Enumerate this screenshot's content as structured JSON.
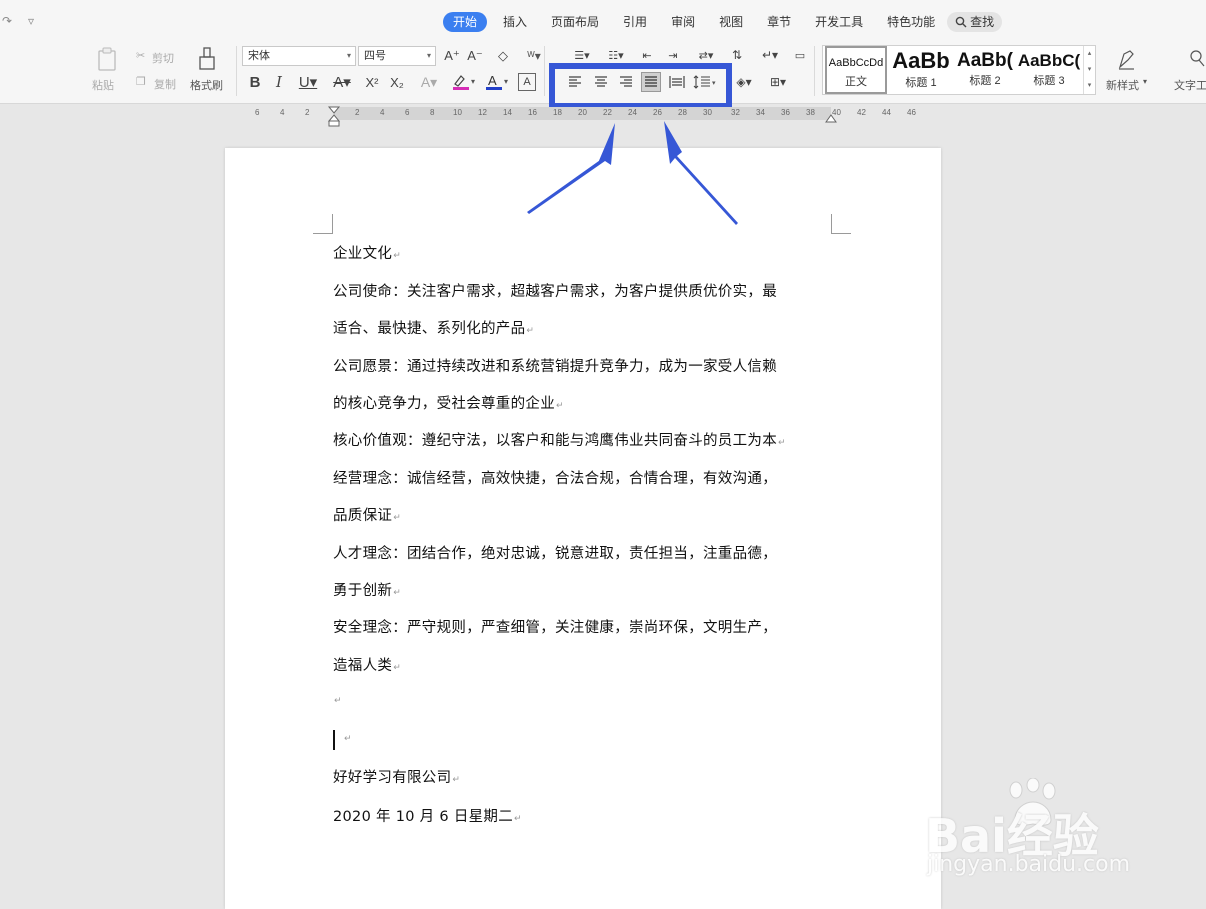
{
  "quick_access": {
    "redo_icon": "redo-icon",
    "more_icon": "dropdown-icon"
  },
  "tabs": [
    "开始",
    "插入",
    "页面布局",
    "引用",
    "审阅",
    "视图",
    "章节",
    "开发工具",
    "特色功能"
  ],
  "search_tab": "查找",
  "clipboard": {
    "paste": "粘贴",
    "cut": "剪切",
    "copy": "复制",
    "format_painter": "格式刷"
  },
  "font": {
    "family": "宋体",
    "size": "四号"
  },
  "styles": [
    {
      "preview": "AaBbCcDd",
      "name": "正文"
    },
    {
      "preview": "AaBb",
      "name": "标题 1"
    },
    {
      "preview": "AaBb(",
      "name": "标题 2"
    },
    {
      "preview": "AaBbC(",
      "name": "标题 3"
    }
  ],
  "new_style": "新样式",
  "text_tool": "文字工",
  "ruler_marks": [
    "6",
    "4",
    "2",
    "2",
    "4",
    "6",
    "8",
    "10",
    "12",
    "14",
    "16",
    "18",
    "20",
    "22",
    "24",
    "26",
    "28",
    "30",
    "32",
    "34",
    "36",
    "38",
    "40",
    "42",
    "44",
    "46"
  ],
  "document": {
    "lines": [
      "企业文化",
      "公司使命：关注客户需求，超越客户需求，为客户提供质优价实，最",
      "适合、最快捷、系列化的产品",
      "公司愿景：通过持续改进和系统营销提升竞争力，成为一家受人信赖",
      "的核心竞争力，受社会尊重的企业",
      "核心价值观：遵纪守法，以客户和能与鸿鹰伟业共同奋斗的员工为本",
      "经营理念：诚信经营，高效快捷，合法合规，合情合理，有效沟通，",
      "品质保证",
      "人才理念：团结合作，绝对忠诚，锐意进取，责任担当，注重品德，",
      "勇于创新",
      "安全理念：严守规则，严查细管，关注健康，崇尚环保，文明生产，",
      "造福人类",
      "",
      "",
      "好好学习有限公司",
      "2020 年 10 月 6 日星期二"
    ],
    "paragraph_mark": "↵"
  },
  "watermark": {
    "main": "Bai经验",
    "sub": "jingyan.baidu.com"
  },
  "colors": {
    "accent": "#3b7ff0",
    "highlight": "#3657d6"
  }
}
